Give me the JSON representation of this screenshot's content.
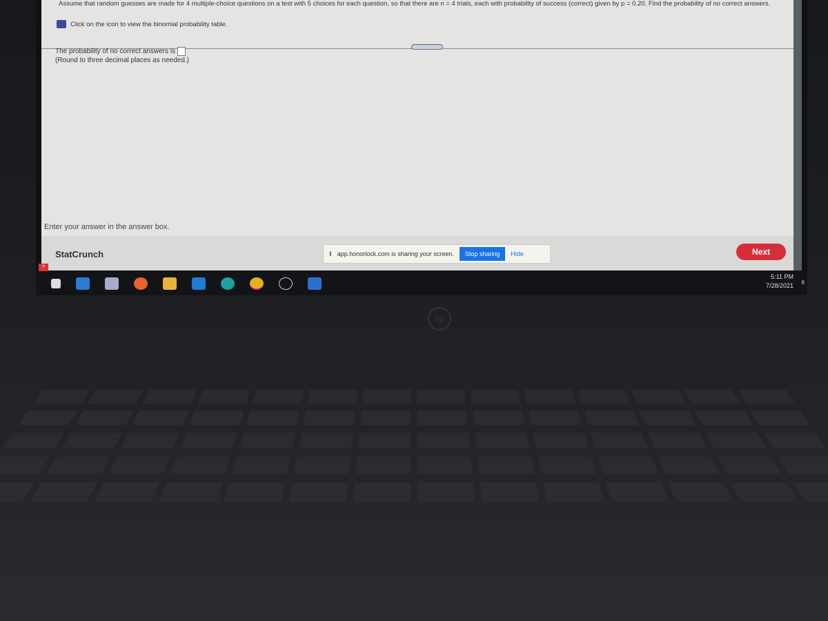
{
  "question": {
    "text": "Assume that random guesses are made for 4 multiple-choice questions on a test with 5 choices for each question, so that there are n = 4 trials, each with probability of success (correct) given by p = 0.20. Find the probability of no correct answers.",
    "hint": "Click on the icon to view the binomial probability table.",
    "answer_prompt": "The probability of no correct answers is",
    "answer_value": "",
    "round_note": "(Round to three decimal places as needed.)",
    "instruction": "Enter your answer in the answer box."
  },
  "bottom_bar": {
    "brand": "StatCrunch",
    "next_label": "Next"
  },
  "share_notice": {
    "text": "app.honorlock.com is sharing your screen.",
    "stop_label": "Stop sharing",
    "hide_label": "Hide"
  },
  "taskbar": {
    "time": "5:11 PM",
    "date": "7/28/2021",
    "notification_count": "6",
    "icons": [
      "windows-icon",
      "edge-legacy-icon",
      "paint-icon",
      "firefox-icon",
      "file-explorer-icon",
      "mail-icon",
      "edge-icon",
      "chrome-icon",
      "globe-icon",
      "honorlock-icon"
    ]
  },
  "laptop_logo": "hp",
  "colors": {
    "next": "#d62f3a",
    "stop_sharing": "#1a73e8"
  }
}
